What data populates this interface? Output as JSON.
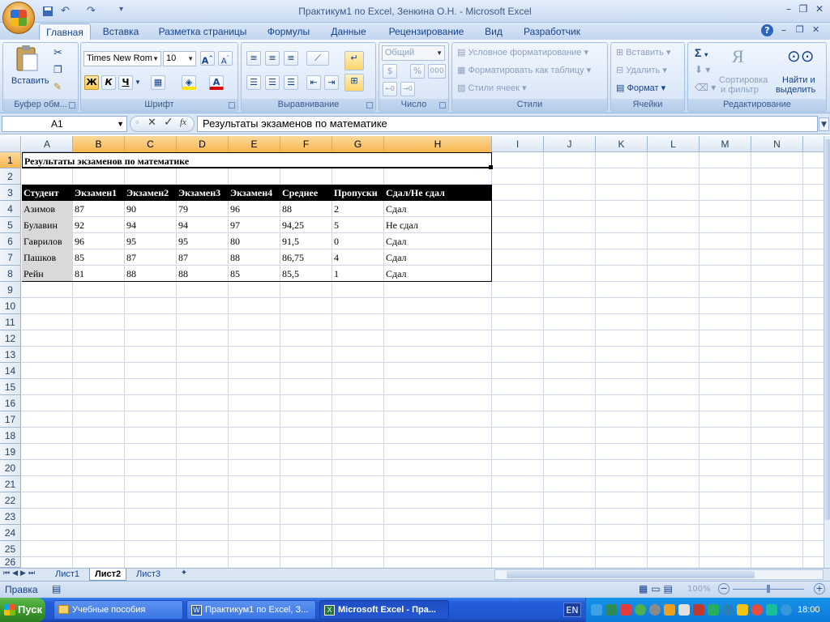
{
  "window": {
    "title": "Практикум1 по Excel, Зенкина О.Н. - Microsoft Excel"
  },
  "tabs": [
    "Главная",
    "Вставка",
    "Разметка страницы",
    "Формулы",
    "Данные",
    "Рецензирование",
    "Вид",
    "Разработчик"
  ],
  "active_tab": "Главная",
  "ribbon": {
    "clipboard": {
      "label": "Буфер обм...",
      "paste": "Вставить"
    },
    "font": {
      "label": "Шрифт",
      "name": "Times New Rom",
      "size": "10",
      "bold": "Ж",
      "italic": "К",
      "underline": "Ч",
      "color_letter": "A"
    },
    "alignment": {
      "label": "Выравнивание"
    },
    "number": {
      "label": "Число",
      "format": "Общий",
      "percent": "%",
      "thousands": "000"
    },
    "styles": {
      "label": "Стили",
      "conditional": "Условное форматирование",
      "as_table": "Форматировать как таблицу",
      "cell_styles": "Стили ячеек"
    },
    "cells": {
      "label": "Ячейки",
      "insert": "Вставить",
      "delete": "Удалить",
      "format": "Формат"
    },
    "editing": {
      "label": "Редактирование",
      "sort_1": "Сортировка",
      "sort_2": "и фильтр",
      "find_1": "Найти и",
      "find_2": "выделить"
    }
  },
  "formula_bar": {
    "name_box": "A1",
    "fx": "fx",
    "content": "Результаты экзаменов по математике"
  },
  "columns": [
    "A",
    "B",
    "C",
    "D",
    "E",
    "F",
    "G",
    "H",
    "I",
    "J",
    "K",
    "L",
    "M",
    "N"
  ],
  "rows": [
    "1",
    "2",
    "3",
    "4",
    "5",
    "6",
    "7",
    "8",
    "9",
    "10",
    "11",
    "12",
    "13",
    "14",
    "15",
    "16",
    "17",
    "18",
    "19",
    "20",
    "21",
    "22",
    "23",
    "24",
    "25",
    "26"
  ],
  "sheet": {
    "title": "Результаты экзаменов по математике",
    "headers": [
      "Студент",
      "Экзамен1",
      "Экзамен2",
      "Экзамен3",
      "Экзамен4",
      "Среднее",
      "Пропуски",
      "Сдал/Не сдал"
    ],
    "data": [
      [
        "Азимов",
        "87",
        "90",
        "79",
        "96",
        "88",
        "2",
        "Сдал"
      ],
      [
        "Булавин",
        "92",
        "94",
        "94",
        "97",
        "94,25",
        "5",
        "Не сдал"
      ],
      [
        "Гаврилов",
        "96",
        "95",
        "95",
        "80",
        "91,5",
        "0",
        "Сдал"
      ],
      [
        "Пашков",
        "85",
        "87",
        "87",
        "88",
        "86,75",
        "4",
        "Сдал"
      ],
      [
        "Рейн",
        "81",
        "88",
        "88",
        "85",
        "85,5",
        "1",
        "Сдал"
      ]
    ]
  },
  "sheet_tabs": [
    "Лист1",
    "Лист2",
    "Лист3"
  ],
  "active_sheet": "Лист2",
  "status": {
    "mode": "Правка",
    "zoom": "100%"
  },
  "taskbar": {
    "start": "Пуск",
    "items": [
      "Учебные пособия",
      "Практикум1 по Excel, З...",
      "Microsoft Excel - Пра..."
    ],
    "lang": "EN",
    "clock": "18:00"
  },
  "colors": {
    "header_fill": "#000000",
    "selected_header": "#f7b64f",
    "ribbon": "#dbe8f8",
    "taskbar": "#245edb"
  }
}
